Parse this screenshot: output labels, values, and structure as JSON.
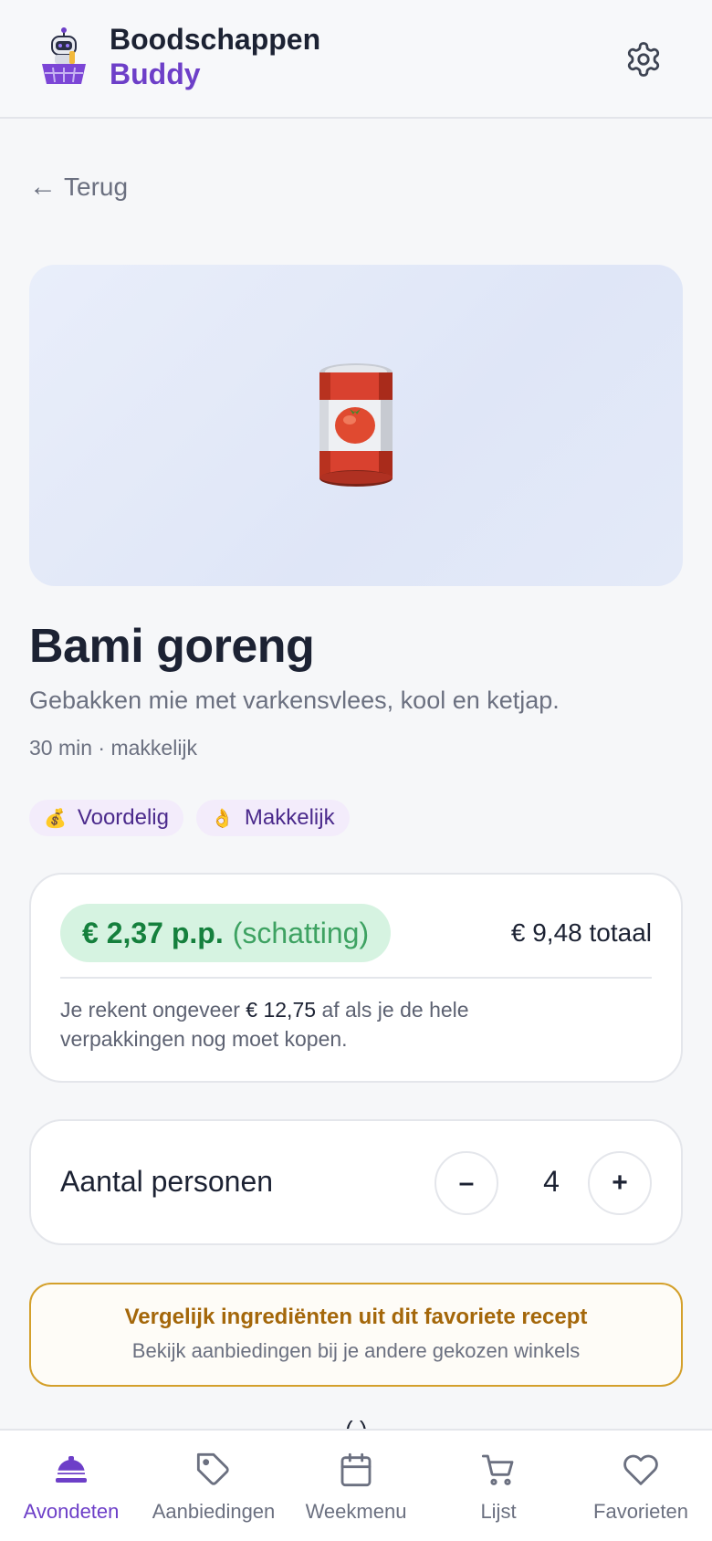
{
  "header": {
    "brand_line1": "Boodschappen",
    "brand_line2": "Buddy",
    "settings_icon": "gear-icon"
  },
  "back": {
    "arrow": "←",
    "label": "Terug"
  },
  "hero": {
    "icon": "tomato-can-icon"
  },
  "recipe": {
    "title": "Bami goreng",
    "subtitle": "Gebakken mie met varkensvlees, kool en ketjap.",
    "meta": "30 min · makkelijk",
    "tags": [
      {
        "emoji": "💰",
        "label": "Voordelig"
      },
      {
        "emoji": "👌",
        "label": "Makkelijk"
      }
    ]
  },
  "price": {
    "per_person": "€ 2,37 p.p.",
    "estimate": "(schatting)",
    "total": "€ 9,48 totaal",
    "note_prefix": "Je rekent ongeveer",
    "note_amount": "€ 12,75",
    "note_suffix": "af als je de hele verpakkingen nog moet kopen."
  },
  "persons": {
    "label": "Aantal personen",
    "minus": "–",
    "count": "4",
    "plus": "+"
  },
  "compare": {
    "title": "Vergelijk ingrediënten uit dit favoriete recept",
    "subtitle": "Bekijk aanbiedingen bij je andere gekozen winkels"
  },
  "peek_text": "( )",
  "colors": {
    "accent": "#6d3fc8",
    "price_green": "#15803d",
    "compare_border": "#d4a02b",
    "compare_text": "#a4670a"
  },
  "nav": [
    {
      "label": "Avondeten",
      "icon": "cloche-icon",
      "active": true
    },
    {
      "label": "Aanbiedingen",
      "icon": "tag-icon",
      "active": false
    },
    {
      "label": "Weekmenu",
      "icon": "calendar-icon",
      "active": false
    },
    {
      "label": "Lijst",
      "icon": "cart-icon",
      "active": false
    },
    {
      "label": "Favorieten",
      "icon": "heart-icon",
      "active": false
    }
  ]
}
